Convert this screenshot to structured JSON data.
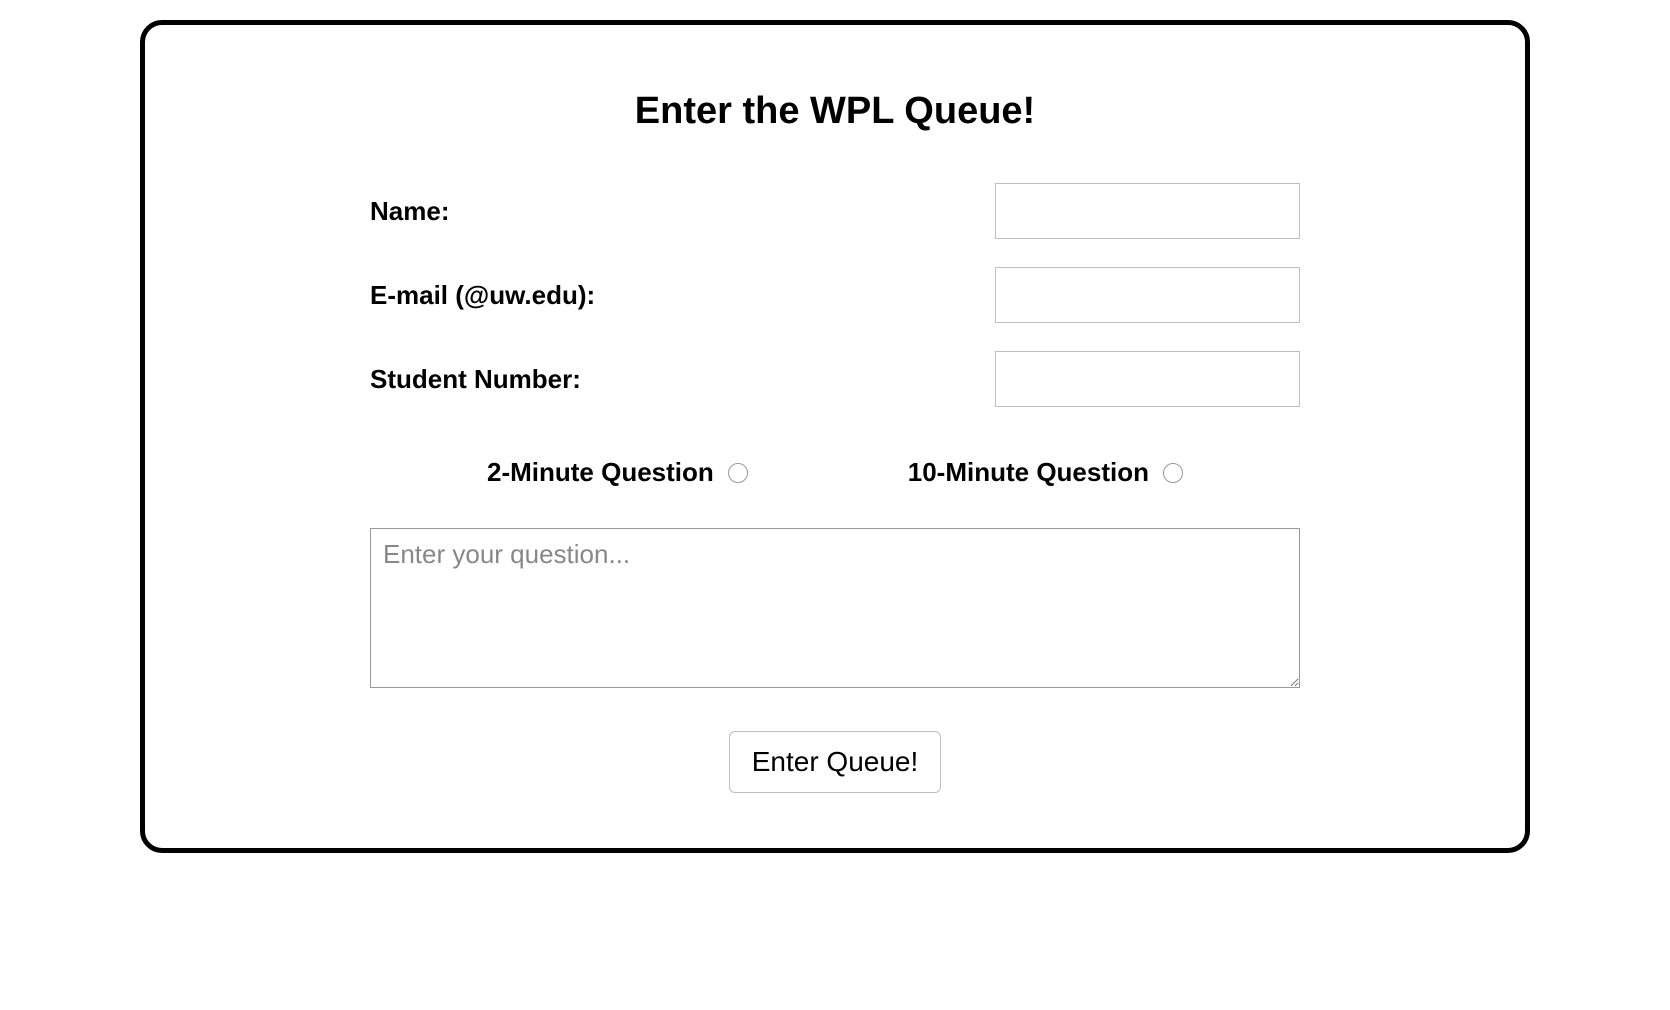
{
  "form": {
    "title": "Enter the WPL Queue!",
    "fields": {
      "name": {
        "label": "Name:",
        "value": ""
      },
      "email": {
        "label": "E-mail (@uw.edu):",
        "value": ""
      },
      "student_number": {
        "label": "Student Number:",
        "value": ""
      }
    },
    "question_type": {
      "options": [
        {
          "label": "2-Minute Question"
        },
        {
          "label": "10-Minute Question"
        }
      ]
    },
    "question_box": {
      "placeholder": "Enter your question...",
      "value": ""
    },
    "submit_label": "Enter Queue!"
  }
}
